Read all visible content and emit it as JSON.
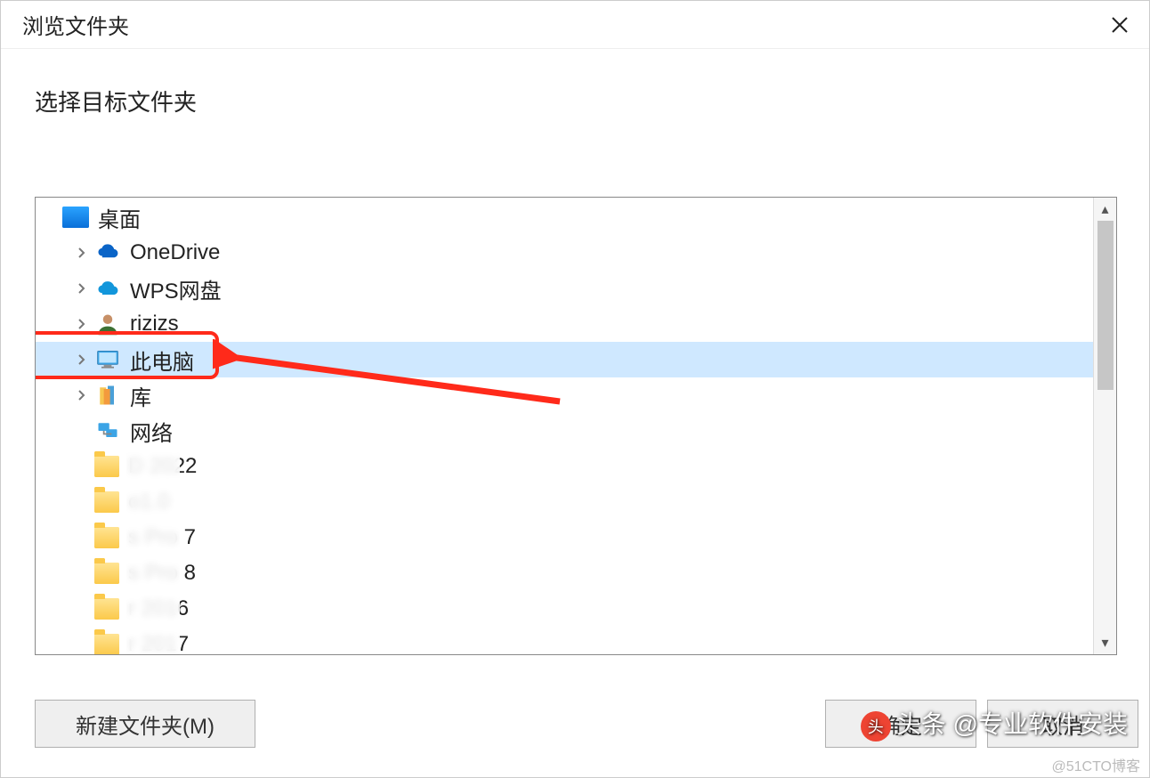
{
  "dialog": {
    "title": "浏览文件夹",
    "prompt": "选择目标文件夹"
  },
  "tree": {
    "items": [
      {
        "id": "desktop",
        "label": "桌面",
        "indent": 0,
        "expandable": false,
        "iconType": "desktop",
        "selected": false
      },
      {
        "id": "onedrive",
        "label": "OneDrive",
        "indent": 1,
        "expandable": true,
        "iconType": "onedrive",
        "selected": false
      },
      {
        "id": "wps",
        "label": "WPS网盘",
        "indent": 1,
        "expandable": true,
        "iconType": "wps",
        "selected": false
      },
      {
        "id": "user",
        "label": "rizizs",
        "indent": 1,
        "expandable": true,
        "iconType": "user",
        "selected": false
      },
      {
        "id": "thispc",
        "label": "此电脑",
        "indent": 1,
        "expandable": true,
        "iconType": "thispc",
        "selected": true
      },
      {
        "id": "libraries",
        "label": "库",
        "indent": 1,
        "expandable": true,
        "iconType": "libraries",
        "selected": false
      },
      {
        "id": "network",
        "label": "网络",
        "indent": 1,
        "expandable": false,
        "iconType": "network",
        "selected": false
      },
      {
        "id": "f1",
        "label": "D 2022",
        "indent": 1,
        "expandable": false,
        "iconType": "folder",
        "selected": false,
        "blurred": true
      },
      {
        "id": "f2",
        "label": "o1.0",
        "indent": 1,
        "expandable": false,
        "iconType": "folder",
        "selected": false,
        "blurred": true
      },
      {
        "id": "f3",
        "label": "s Pro 7",
        "indent": 1,
        "expandable": false,
        "iconType": "folder",
        "selected": false,
        "blurred": true
      },
      {
        "id": "f4",
        "label": "s Pro 8",
        "indent": 1,
        "expandable": false,
        "iconType": "folder",
        "selected": false,
        "blurred": true
      },
      {
        "id": "f5",
        "label": "r 2016",
        "indent": 1,
        "expandable": false,
        "iconType": "folder",
        "selected": false,
        "blurred": true
      },
      {
        "id": "f6",
        "label": "r 2017",
        "indent": 1,
        "expandable": false,
        "iconType": "folder",
        "selected": false,
        "blurred": true
      }
    ]
  },
  "buttons": {
    "newFolder": "新建文件夹(M)",
    "ok": "确定",
    "cancel": "取消"
  },
  "watermarks": {
    "corner": "@51CTO博客",
    "overlay": "头条 @专业软件安装"
  }
}
